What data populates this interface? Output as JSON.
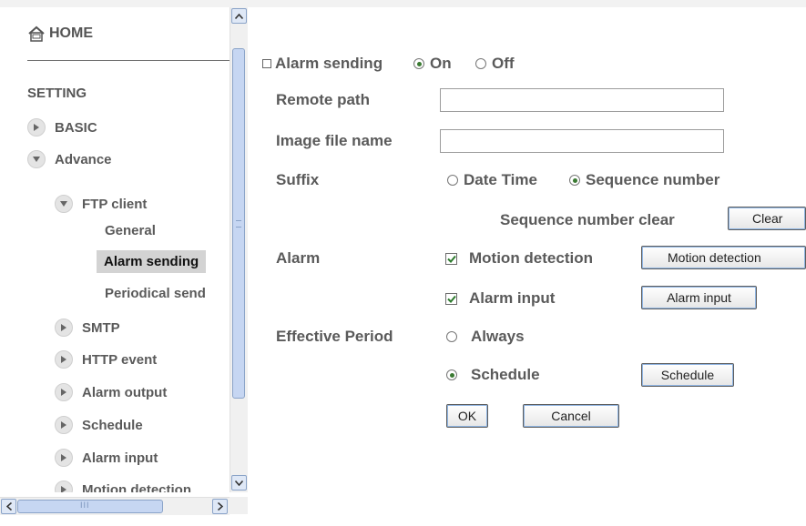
{
  "nav": {
    "home": "HOME",
    "setting": "SETTING",
    "items": {
      "basic": "BASIC",
      "advance": "Advance",
      "ftp_client": "FTP client",
      "general": "General",
      "alarm_sending": "Alarm sending",
      "periodical_sending": "Periodical send",
      "smtp": "SMTP",
      "http_event": "HTTP event",
      "alarm_output": "Alarm output",
      "schedule": "Schedule",
      "alarm_input": "Alarm input",
      "motion_detection": "Motion detection"
    },
    "hscroll_grip": "III"
  },
  "form": {
    "alarm_sending_label": "Alarm sending",
    "on_label": "On",
    "off_label": "Off",
    "alarm_sending_value": "On",
    "remote_path_label": "Remote path",
    "remote_path_value": "",
    "image_file_name_label": "Image file name",
    "image_file_name_value": "",
    "suffix_label": "Suffix",
    "suffix_options": [
      "Date Time",
      "Sequence number"
    ],
    "suffix_value": "Sequence number",
    "seq_clear_label": "Sequence number clear",
    "clear_button": "Clear",
    "alarm_label": "Alarm",
    "motion_detection_label": "Motion detection",
    "motion_detection_checked": true,
    "motion_detection_button": "Motion detection",
    "alarm_input_label": "Alarm input",
    "alarm_input_checked": true,
    "alarm_input_button": "Alarm input",
    "effective_period_label": "Effective Period",
    "always_label": "Always",
    "schedule_label": "Schedule",
    "effective_period_value": "Schedule",
    "schedule_button": "Schedule",
    "ok_button": "OK",
    "cancel_button": "Cancel"
  },
  "colors": {
    "text": "#5a5a5a",
    "radio_dot": "#3a7a32",
    "check_mark": "#2d7a2d",
    "active_nav_bg": "#d3d3d3",
    "scroll_thumb": "#c6d6f2"
  }
}
